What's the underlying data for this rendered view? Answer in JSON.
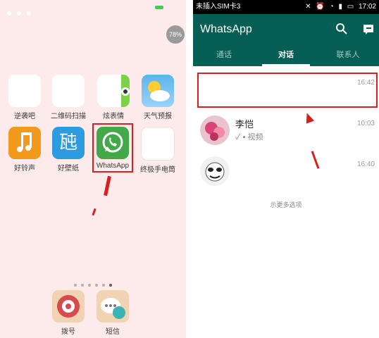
{
  "home": {
    "badge": "78%",
    "apps_row1": [
      {
        "label": "逆袭吧",
        "icon": "blank-app-icon"
      },
      {
        "label": "二维码扫描",
        "icon": "qr-scan-icon"
      },
      {
        "label": "炫表情",
        "icon": "emoji-icon"
      },
      {
        "label": "天气预报",
        "icon": "weather-icon"
      }
    ],
    "apps_row2": [
      {
        "label": "好铃声",
        "icon": "music-note-icon"
      },
      {
        "label": "好壁纸",
        "icon": "wallpaper-icon"
      },
      {
        "label": "WhatsApp",
        "icon": "whatsapp-icon"
      },
      {
        "label": "终极手电筒",
        "icon": "flashlight-icon"
      }
    ],
    "wallpaper_icon_text": "瓲",
    "dock": [
      {
        "label": "拨号",
        "icon": "dialer-icon"
      },
      {
        "label": "短信",
        "icon": "messages-icon"
      }
    ]
  },
  "whatsapp": {
    "statusbar": {
      "carrier": "未插入SIM卡3",
      "time": "17:02"
    },
    "title": "WhatsApp",
    "tabs": [
      {
        "label": "通话",
        "active": false
      },
      {
        "label": "对话",
        "active": true
      },
      {
        "label": "联系人",
        "active": false
      }
    ],
    "chats": [
      {
        "name": "",
        "preview": "",
        "time": "16:42"
      },
      {
        "name": "李恺",
        "preview": "✓ ▪ 视频",
        "time": "10:03"
      },
      {
        "name": "",
        "preview": "",
        "time": "16:40"
      }
    ],
    "hint": "示更多选项"
  },
  "colors": {
    "whatsapp_green": "#075e54",
    "highlight_red": "#d81f1f",
    "home_bg": "#fcebea"
  }
}
